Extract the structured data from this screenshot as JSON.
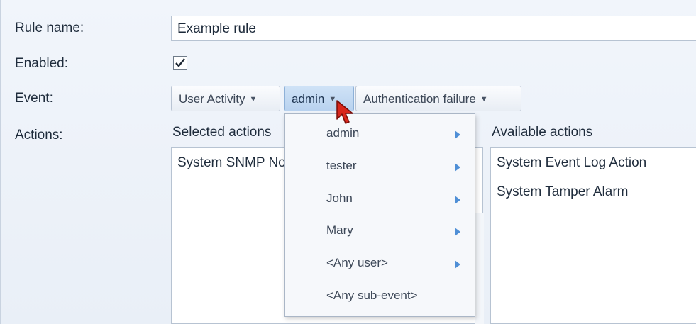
{
  "form": {
    "rule_name_label": "Rule name:",
    "rule_name_value": "Example rule",
    "enabled_label": "Enabled:",
    "enabled_checked": true,
    "event_label": "Event:",
    "actions_label": "Actions:"
  },
  "event": {
    "category": "User Activity",
    "user": "admin",
    "sub_event": "Authentication failure"
  },
  "actions": {
    "selected_header": "Selected actions",
    "selected_items": [
      "System SNMP Notification"
    ],
    "available_header": "Available actions",
    "available_items": [
      "System Event Log Action",
      "System Tamper Alarm"
    ]
  },
  "dropdown": {
    "items": [
      {
        "label": "admin",
        "has_submenu": true
      },
      {
        "label": "tester",
        "has_submenu": true
      },
      {
        "label": "John",
        "has_submenu": true
      },
      {
        "label": "Mary",
        "has_submenu": true
      },
      {
        "label": "<Any user>",
        "has_submenu": true
      },
      {
        "label": "<Any sub-event>",
        "has_submenu": false
      }
    ]
  },
  "colors": {
    "panel_bg": "#eef3f9",
    "active_button": "#c4dbf3",
    "submenu_arrow": "#4f8fd6",
    "cursor": "#d9261c"
  },
  "icons": {
    "dropdown_caret": "caret-down-icon",
    "submenu": "triangle-right-icon",
    "checkbox": "check-icon",
    "cursor": "mouse-pointer-icon"
  }
}
